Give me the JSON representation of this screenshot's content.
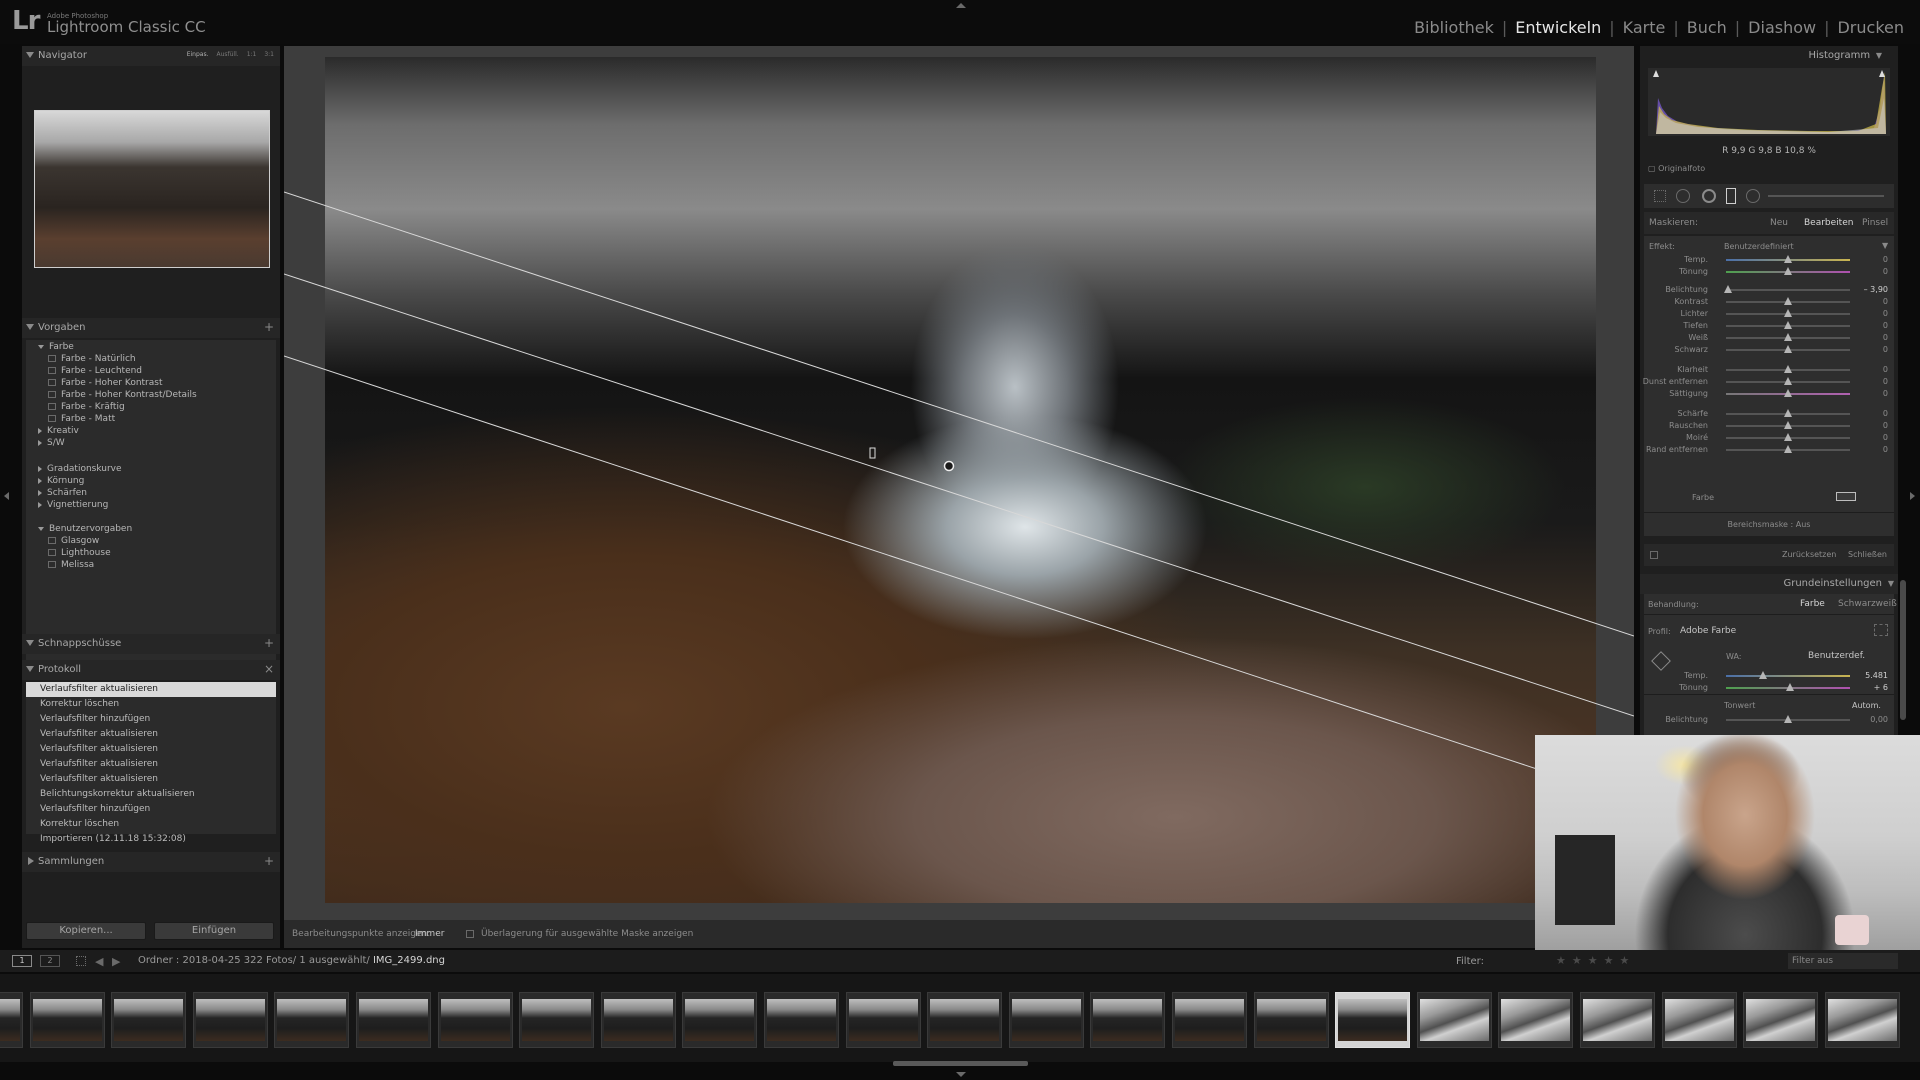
{
  "app": {
    "vendor": "Adobe Photoshop",
    "name": "Lightroom Classic CC",
    "logo": "Lr"
  },
  "modules": [
    {
      "label": "Bibliothek",
      "active": false
    },
    {
      "label": "Entwickeln",
      "active": true
    },
    {
      "label": "Karte",
      "active": false
    },
    {
      "label": "Buch",
      "active": false
    },
    {
      "label": "Diashow",
      "active": false
    },
    {
      "label": "Drucken",
      "active": false
    }
  ],
  "left": {
    "navigator": {
      "title": "Navigator",
      "zoom": [
        "Einpas.",
        "Ausfüll.",
        "1:1",
        "3:1"
      ]
    },
    "presets": {
      "title": "Vorgaben",
      "items": [
        {
          "label": "Farbe",
          "kind": "group-open"
        },
        {
          "label": "Farbe - Natürlich",
          "kind": "preset"
        },
        {
          "label": "Farbe - Leuchtend",
          "kind": "preset"
        },
        {
          "label": "Farbe - Hoher Kontrast",
          "kind": "preset"
        },
        {
          "label": "Farbe - Hoher Kontrast/Details",
          "kind": "preset"
        },
        {
          "label": "Farbe - Kräftig",
          "kind": "preset"
        },
        {
          "label": "Farbe - Matt",
          "kind": "preset"
        },
        {
          "label": "Kreativ",
          "kind": "group"
        },
        {
          "label": "S/W",
          "kind": "group"
        },
        {
          "label": "Gradationskurve",
          "kind": "group"
        },
        {
          "label": "Körnung",
          "kind": "group"
        },
        {
          "label": "Schärfen",
          "kind": "group"
        },
        {
          "label": "Vignettierung",
          "kind": "group"
        },
        {
          "label": "Benutzervorgaben",
          "kind": "group-open"
        },
        {
          "label": "Glasgow",
          "kind": "preset"
        },
        {
          "label": "Lighthouse",
          "kind": "preset"
        },
        {
          "label": "Melissa",
          "kind": "preset"
        }
      ]
    },
    "snapshots": {
      "title": "Schnappschüsse"
    },
    "history": {
      "title": "Protokoll",
      "items": [
        "Verlaufsfilter aktualisieren",
        "Korrektur löschen",
        "Verlaufsfilter hinzufügen",
        "Verlaufsfilter aktualisieren",
        "Verlaufsfilter aktualisieren",
        "Verlaufsfilter aktualisieren",
        "Verlaufsfilter aktualisieren",
        "Belichtungskorrektur aktualisieren",
        "Verlaufsfilter hinzufügen",
        "Korrektur löschen",
        "Importieren (12.11.18 15:32:08)"
      ]
    },
    "collections": {
      "title": "Sammlungen"
    },
    "copy_label": "Kopieren...",
    "paste_label": "Einfügen"
  },
  "toolbar": {
    "edit_points_label": "Bearbeitungspunkte anzeigen:",
    "edit_points_value": "Immer",
    "overlay_label": "Überlagerung für ausgewählte Maske anzeigen"
  },
  "right": {
    "histogram_title": "Histogramm",
    "hist_values": "R  9,9  G  9,8  B  10,8 %",
    "original_photo": "Originalfoto",
    "mask_label": "Maskieren:",
    "mask_new": "Neu",
    "mask_edit": "Bearbeiten",
    "mask_brush": "Pinsel",
    "effect_label": "Effekt:",
    "effect_value": "Benutzerdefiniert",
    "sliders": [
      {
        "label": "Temp.",
        "value": "0",
        "pos": 0.5
      },
      {
        "label": "Tönung",
        "value": "0",
        "pos": 0.5
      },
      {
        "label": "Belichtung",
        "value": "– 3,90",
        "pos": 0.02
      },
      {
        "label": "Kontrast",
        "value": "0",
        "pos": 0.5
      },
      {
        "label": "Lichter",
        "value": "0",
        "pos": 0.5
      },
      {
        "label": "Tiefen",
        "value": "0",
        "pos": 0.5
      },
      {
        "label": "Weiß",
        "value": "0",
        "pos": 0.5
      },
      {
        "label": "Schwarz",
        "value": "0",
        "pos": 0.5
      },
      {
        "label": "Klarheit",
        "value": "0",
        "pos": 0.5
      },
      {
        "label": "Dunst entfernen",
        "value": "0",
        "pos": 0.5
      },
      {
        "label": "Sättigung",
        "value": "0",
        "pos": 0.5
      },
      {
        "label": "Schärfe",
        "value": "0",
        "pos": 0.5
      },
      {
        "label": "Rauschen",
        "value": "0",
        "pos": 0.5
      },
      {
        "label": "Moiré",
        "value": "0",
        "pos": 0.5
      },
      {
        "label": "Rand entfernen",
        "value": "0",
        "pos": 0.5
      }
    ],
    "color_label": "Farbe",
    "range_mask": "Bereichsmaske : Aus",
    "reset_label": "Zurücksetzen",
    "close_label": "Schließen",
    "basic_title": "Grundeinstellungen",
    "treatment_label": "Behandlung:",
    "treatment_color": "Farbe",
    "treatment_bw": "Schwarzweiß",
    "profile_label": "Profil:",
    "profile_value": "Adobe Farbe",
    "wb_label": "WA:",
    "wb_value": "Benutzerdef.",
    "wb_sliders": [
      {
        "label": "Temp.",
        "value": "5.481",
        "pos": 0.3
      },
      {
        "label": "Tönung",
        "value": "+ 6",
        "pos": 0.52
      }
    ],
    "tone_label": "Tonwert",
    "tone_auto": "Autom.",
    "exposure_label": "Belichtung",
    "exposure_value": "0,00"
  },
  "filmstrip": {
    "page1": "1",
    "page2": "2",
    "info_prefix": "Ordner : 2018-04-25   322 Fotos/  1 ausgewählt/",
    "filename": "IMG_2499.dng",
    "filter_label": "Filter:",
    "filter_value": "Filter aus",
    "thumbs": [
      "c",
      "c",
      "c",
      "c",
      "c",
      "c",
      "c",
      "c",
      "c",
      "c",
      "c",
      "c",
      "c",
      "c",
      "c",
      "c",
      "c",
      "sel",
      "bw",
      "bw",
      "bw",
      "bw",
      "bw",
      "bw"
    ]
  }
}
